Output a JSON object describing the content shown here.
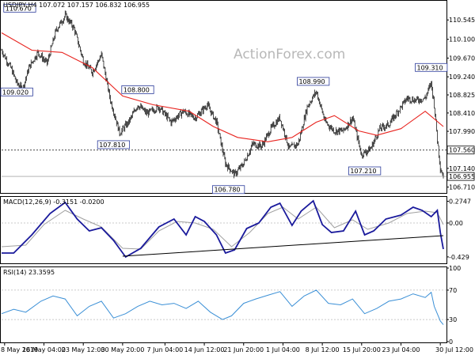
{
  "chart_data": [
    {
      "type": "candlestick",
      "title": "USDJPY,H4  107.072 107.157 106.832 106.955",
      "watermark": "ActionForex.com",
      "ylim": [
        106.63,
        110.93
      ],
      "yticks": [
        "110.545",
        "110.100",
        "109.670",
        "109.240",
        "108.825",
        "108.410",
        "107.990",
        "107.560",
        "107.140",
        "106.710"
      ],
      "current_price": "106.955",
      "reference_level": "107.560",
      "annotations": [
        {
          "label": "110.670",
          "time": 6,
          "value": 110.67
        },
        {
          "label": "109.020",
          "time": 0.3,
          "value": 109.02
        },
        {
          "label": "108.800",
          "time": 45,
          "value": 108.8
        },
        {
          "label": "107.810",
          "time": 37,
          "value": 107.81
        },
        {
          "label": "106.780",
          "time": 75,
          "value": 106.78
        },
        {
          "label": "108.990",
          "time": 103,
          "value": 108.99
        },
        {
          "label": "107.210",
          "time": 120,
          "value": 107.21
        },
        {
          "label": "109.310",
          "time": 142,
          "value": 109.31
        }
      ],
      "anchors": [
        [
          0,
          109.85
        ],
        [
          3,
          109.45
        ],
        [
          5,
          109.1
        ],
        [
          7,
          108.95
        ],
        [
          9,
          109.45
        ],
        [
          12,
          109.8
        ],
        [
          15,
          109.55
        ],
        [
          18,
          110.3
        ],
        [
          21,
          110.65
        ],
        [
          24,
          110.35
        ],
        [
          27,
          109.6
        ],
        [
          30,
          109.35
        ],
        [
          33,
          109.75
        ],
        [
          36,
          108.7
        ],
        [
          39,
          107.95
        ],
        [
          42,
          108.2
        ],
        [
          45,
          108.6
        ],
        [
          48,
          108.4
        ],
        [
          52,
          108.55
        ],
        [
          56,
          108.2
        ],
        [
          60,
          108.45
        ],
        [
          64,
          108.3
        ],
        [
          68,
          108.6
        ],
        [
          71,
          108.2
        ],
        [
          74,
          107.25
        ],
        [
          77,
          107.0
        ],
        [
          80,
          107.25
        ],
        [
          83,
          107.7
        ],
        [
          86,
          107.65
        ],
        [
          89,
          108.05
        ],
        [
          92,
          108.3
        ],
        [
          95,
          107.6
        ],
        [
          98,
          107.7
        ],
        [
          101,
          108.55
        ],
        [
          104,
          108.9
        ],
        [
          107,
          108.2
        ],
        [
          110,
          108.0
        ],
        [
          113,
          108.0
        ],
        [
          116,
          108.3
        ],
        [
          119,
          107.45
        ],
        [
          122,
          107.6
        ],
        [
          125,
          108.05
        ],
        [
          128,
          108.15
        ],
        [
          131,
          108.45
        ],
        [
          134,
          108.75
        ],
        [
          137,
          108.7
        ],
        [
          140,
          108.75
        ],
        [
          142,
          109.1
        ],
        [
          143,
          108.6
        ],
        [
          144,
          107.8
        ],
        [
          145,
          107.15
        ],
        [
          146,
          106.96
        ]
      ],
      "ma_anchors": [
        [
          0,
          110.25
        ],
        [
          10,
          109.85
        ],
        [
          20,
          109.8
        ],
        [
          30,
          109.45
        ],
        [
          40,
          108.8
        ],
        [
          50,
          108.6
        ],
        [
          62,
          108.45
        ],
        [
          70,
          108.1
        ],
        [
          78,
          107.85
        ],
        [
          88,
          107.75
        ],
        [
          96,
          107.85
        ],
        [
          104,
          108.2
        ],
        [
          110,
          108.35
        ],
        [
          118,
          108.0
        ],
        [
          124,
          107.9
        ],
        [
          132,
          108.05
        ],
        [
          140,
          108.45
        ],
        [
          146,
          108.1
        ]
      ]
    },
    {
      "type": "line",
      "title": "MACD(12,26,9) -0.3151 -0.0200",
      "ylim": [
        -0.5,
        0.32
      ],
      "yticks": [
        "0.2747",
        "0.00",
        "-0.429"
      ],
      "series": [
        {
          "points": [
            [
              0,
              -0.38
            ],
            [
              4,
              -0.38
            ],
            [
              10,
              -0.15
            ],
            [
              16,
              0.12
            ],
            [
              21,
              0.26
            ],
            [
              25,
              0.05
            ],
            [
              29,
              -0.1
            ],
            [
              33,
              -0.06
            ],
            [
              37,
              -0.22
            ],
            [
              41,
              -0.43
            ],
            [
              46,
              -0.32
            ],
            [
              52,
              -0.05
            ],
            [
              57,
              0.05
            ],
            [
              61,
              -0.15
            ],
            [
              64,
              0.08
            ],
            [
              67,
              0.02
            ],
            [
              71,
              -0.15
            ],
            [
              74,
              -0.38
            ],
            [
              77,
              -0.34
            ],
            [
              81,
              -0.07
            ],
            [
              85,
              0.0
            ],
            [
              89,
              0.2
            ],
            [
              92,
              0.25
            ],
            [
              96,
              -0.03
            ],
            [
              99,
              0.15
            ],
            [
              103,
              0.28
            ],
            [
              106,
              -0.02
            ],
            [
              109,
              -0.12
            ],
            [
              113,
              -0.1
            ],
            [
              117,
              0.15
            ],
            [
              120,
              -0.15
            ],
            [
              123,
              -0.1
            ],
            [
              127,
              0.05
            ],
            [
              132,
              0.1
            ],
            [
              136,
              0.2
            ],
            [
              139,
              0.16
            ],
            [
              142,
              0.08
            ],
            [
              144,
              0.16
            ],
            [
              145,
              -0.12
            ],
            [
              146,
              -0.33
            ]
          ]
        },
        {
          "points": [
            [
              0,
              -0.3
            ],
            [
              8,
              -0.28
            ],
            [
              14,
              -0.02
            ],
            [
              21,
              0.16
            ],
            [
              27,
              0.05
            ],
            [
              33,
              -0.05
            ],
            [
              40,
              -0.32
            ],
            [
              46,
              -0.33
            ],
            [
              52,
              -0.1
            ],
            [
              58,
              0.02
            ],
            [
              64,
              0.0
            ],
            [
              70,
              -0.08
            ],
            [
              76,
              -0.3
            ],
            [
              82,
              -0.12
            ],
            [
              88,
              0.12
            ],
            [
              93,
              0.2
            ],
            [
              98,
              0.05
            ],
            [
              104,
              0.2
            ],
            [
              110,
              -0.06
            ],
            [
              116,
              0.04
            ],
            [
              121,
              -0.08
            ],
            [
              128,
              0.0
            ],
            [
              134,
              0.12
            ],
            [
              140,
              0.15
            ],
            [
              144,
              0.13
            ],
            [
              146,
              -0.02
            ]
          ]
        },
        {
          "points": [
            [
              40,
              -0.42
            ],
            [
              146,
              -0.16
            ]
          ]
        }
      ]
    },
    {
      "type": "line",
      "title": "RSI(14) 23.3595",
      "ylim": [
        0,
        100
      ],
      "yticks": [
        "100",
        "70",
        "30",
        "0"
      ],
      "series": [
        {
          "points": [
            [
              0,
              38
            ],
            [
              4,
              44
            ],
            [
              8,
              40
            ],
            [
              13,
              55
            ],
            [
              17,
              62
            ],
            [
              21,
              58
            ],
            [
              25,
              35
            ],
            [
              29,
              48
            ],
            [
              33,
              55
            ],
            [
              37,
              32
            ],
            [
              41,
              38
            ],
            [
              45,
              48
            ],
            [
              49,
              55
            ],
            [
              53,
              50
            ],
            [
              57,
              52
            ],
            [
              61,
              45
            ],
            [
              65,
              55
            ],
            [
              69,
              40
            ],
            [
              73,
              30
            ],
            [
              76,
              35
            ],
            [
              80,
              52
            ],
            [
              84,
              58
            ],
            [
              88,
              63
            ],
            [
              92,
              68
            ],
            [
              96,
              48
            ],
            [
              100,
              62
            ],
            [
              104,
              70
            ],
            [
              108,
              52
            ],
            [
              112,
              50
            ],
            [
              116,
              58
            ],
            [
              120,
              38
            ],
            [
              124,
              45
            ],
            [
              128,
              55
            ],
            [
              132,
              58
            ],
            [
              136,
              65
            ],
            [
              140,
              60
            ],
            [
              142,
              67
            ],
            [
              143,
              48
            ],
            [
              145,
              28
            ],
            [
              146,
              23
            ]
          ]
        }
      ]
    }
  ],
  "x_labels": [
    {
      "t": 1,
      "label": "8 May 2019"
    },
    {
      "t": 14,
      "label": "16 May 04:00"
    },
    {
      "t": 27,
      "label": "23 May 12:00"
    },
    {
      "t": 40,
      "label": "30 May 20:00"
    },
    {
      "t": 54,
      "label": "7 Jun 04:00"
    },
    {
      "t": 67,
      "label": "14 Jun 12:00"
    },
    {
      "t": 80,
      "label": "21 Jun 20:00"
    },
    {
      "t": 93,
      "label": "1 Jul 04:00"
    },
    {
      "t": 106,
      "label": "8 Jul 12:00"
    },
    {
      "t": 119,
      "label": "15 Jul 20:00"
    },
    {
      "t": 132,
      "label": "23 Jul 04:00"
    },
    {
      "t": 145,
      "label": "30 Jul 12:00"
    }
  ],
  "colors": {
    "price": "#000000",
    "ma": "#e8231e",
    "macd": "#1a1a9c",
    "signal": "#a0a0a0",
    "rsi": "#3a8fd6",
    "label_border": "#2a3a9a",
    "grid": "#b8b8b8",
    "refline": "#444444"
  }
}
